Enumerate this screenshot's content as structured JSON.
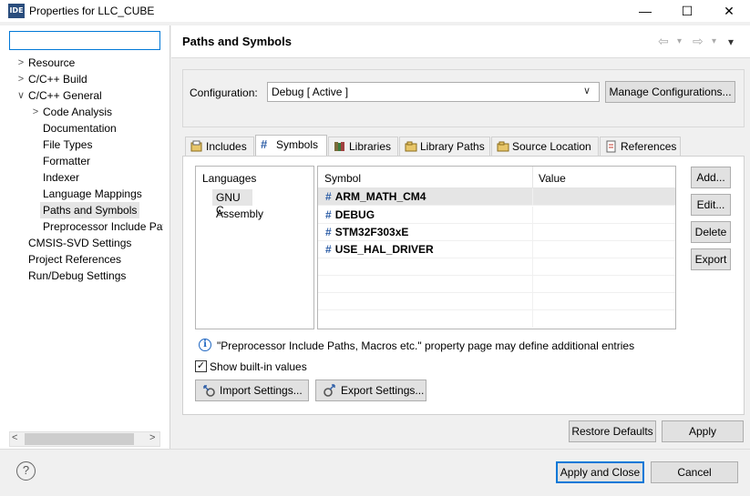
{
  "window": {
    "logo_text": "IDE",
    "title": "Properties for LLC_CUBE",
    "minimize": "—",
    "maximize": "☐",
    "close": "✕"
  },
  "tree": {
    "filter_value": "",
    "items": [
      {
        "label": "Resource",
        "chev": ">"
      },
      {
        "label": "C/C++ Build",
        "chev": ">"
      },
      {
        "label": "C/C++ General",
        "chev": "∨"
      },
      {
        "label": "Code Analysis",
        "chev": ">"
      },
      {
        "label": "Documentation",
        "chev": ""
      },
      {
        "label": "File Types",
        "chev": ""
      },
      {
        "label": "Formatter",
        "chev": ""
      },
      {
        "label": "Indexer",
        "chev": ""
      },
      {
        "label": "Language Mappings",
        "chev": ""
      },
      {
        "label": "Paths and Symbols",
        "chev": ""
      },
      {
        "label": "Preprocessor Include Pat",
        "chev": ""
      },
      {
        "label": "CMSIS-SVD Settings",
        "chev": ""
      },
      {
        "label": "Project References",
        "chev": ""
      },
      {
        "label": "Run/Debug Settings",
        "chev": ""
      }
    ],
    "scroll_left": "<",
    "scroll_right": ">"
  },
  "page": {
    "title": "Paths and Symbols",
    "back": "⇦",
    "forward": "⇨",
    "menu": "▾"
  },
  "config": {
    "label": "Configuration:",
    "value": "Debug  [ Active ]",
    "manage_label": "Manage Configurations..."
  },
  "tabs": [
    "Includes",
    "Symbols",
    "Libraries",
    "Library Paths",
    "Source Location",
    "References"
  ],
  "languages": {
    "header": "Languages",
    "items": [
      "GNU C",
      "Assembly"
    ]
  },
  "symbols": {
    "col_symbol": "Symbol",
    "col_value": "Value",
    "rows": [
      {
        "name": "ARM_MATH_CM4",
        "value": ""
      },
      {
        "name": "DEBUG",
        "value": ""
      },
      {
        "name": "STM32F303xE",
        "value": ""
      },
      {
        "name": "USE_HAL_DRIVER",
        "value": ""
      }
    ],
    "hash": "#"
  },
  "side_buttons": {
    "add": "Add...",
    "edit": "Edit...",
    "delete": "Delete",
    "export": "Export"
  },
  "info": {
    "icon": "i",
    "text": "\"Preprocessor Include Paths, Macros etc.\" property page may define additional entries"
  },
  "show_builtin": {
    "label": "Show built-in values",
    "checked_mark": "✓"
  },
  "import_label": "Import Settings...",
  "export_settings_label": "Export Settings...",
  "restore_defaults": "Restore Defaults",
  "apply": "Apply",
  "apply_close": "Apply and Close",
  "cancel": "Cancel",
  "help_icon": "?",
  "colors": {
    "accent": "#0078d7",
    "hash_blue": "#2f5fa7"
  }
}
